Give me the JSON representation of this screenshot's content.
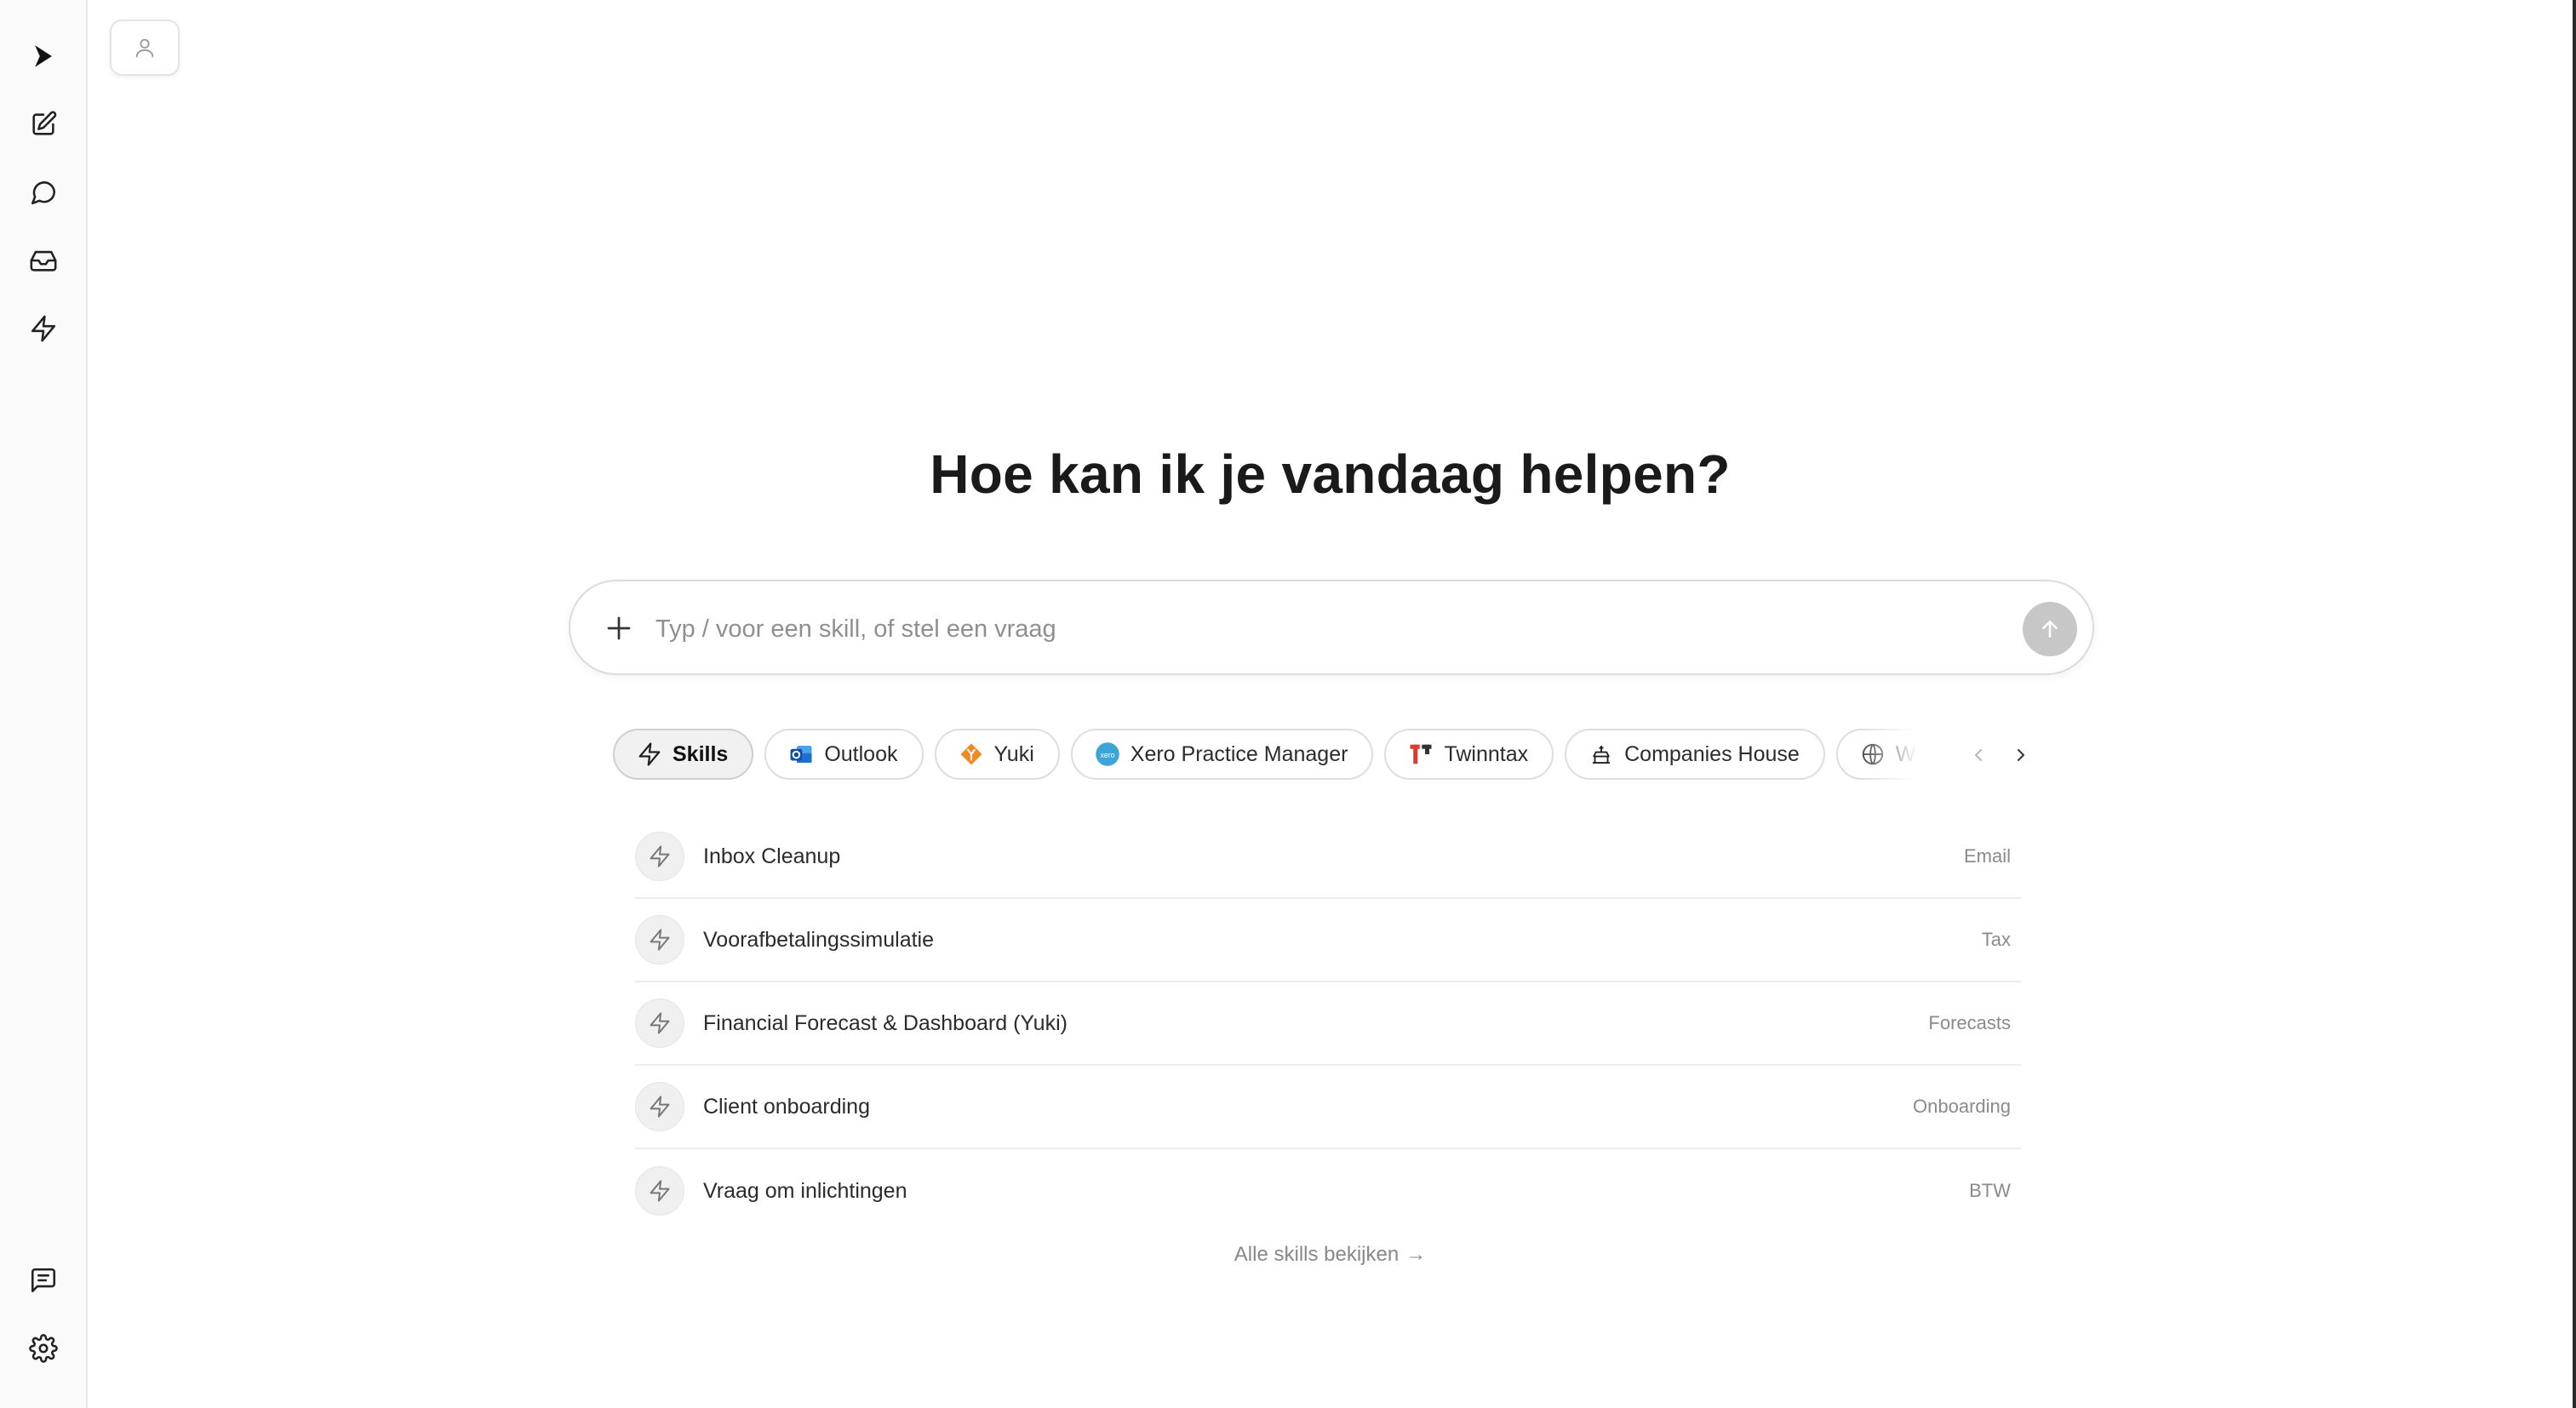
{
  "sidebar": {
    "items": [
      {
        "icon": "play-logo-icon"
      },
      {
        "icon": "new-chat-icon"
      },
      {
        "icon": "chat-bubble-icon"
      },
      {
        "icon": "inbox-icon"
      },
      {
        "icon": "bolt-icon"
      }
    ],
    "bottom_items": [
      {
        "icon": "feedback-icon"
      },
      {
        "icon": "settings-gear-icon"
      }
    ]
  },
  "profile": {
    "icon": "user-icon"
  },
  "main": {
    "heading": "Hoe kan ik je vandaag helpen?",
    "composer": {
      "placeholder": "Typ / voor een skill, of stel een vraag",
      "value": ""
    },
    "chips": [
      {
        "label": "Skills",
        "icon": "bolt-icon",
        "active": true
      },
      {
        "label": "Outlook",
        "icon": "outlook-icon",
        "active": false
      },
      {
        "label": "Yuki",
        "icon": "yuki-icon",
        "active": false
      },
      {
        "label": "Xero Practice Manager",
        "icon": "xero-icon",
        "active": false
      },
      {
        "label": "Twinntax",
        "icon": "twinntax-icon",
        "active": false
      },
      {
        "label": "Companies House",
        "icon": "companies-house-icon",
        "active": false
      },
      {
        "label": "W",
        "icon": "globe-icon",
        "active": false
      }
    ],
    "skills": [
      {
        "name": "Inbox Cleanup",
        "category": "Email"
      },
      {
        "name": "Voorafbetalingssimulatie",
        "category": "Tax"
      },
      {
        "name": "Financial Forecast & Dashboard (Yuki)",
        "category": "Forecasts"
      },
      {
        "name": "Client onboarding",
        "category": "Onboarding"
      },
      {
        "name": "Vraag om inlichtingen",
        "category": "BTW"
      }
    ],
    "all_skills_link": "Alle skills bekijken"
  },
  "colors": {
    "accent": "#1a1a1a",
    "send_disabled": "#c7c7c7",
    "chip_active_bg": "#f1f1f1",
    "outlook_blue": "#1f6fd1",
    "yuki_orange": "#f08a24",
    "xero_blue": "#3aa5d6",
    "twinntax_red": "#d93a32"
  }
}
